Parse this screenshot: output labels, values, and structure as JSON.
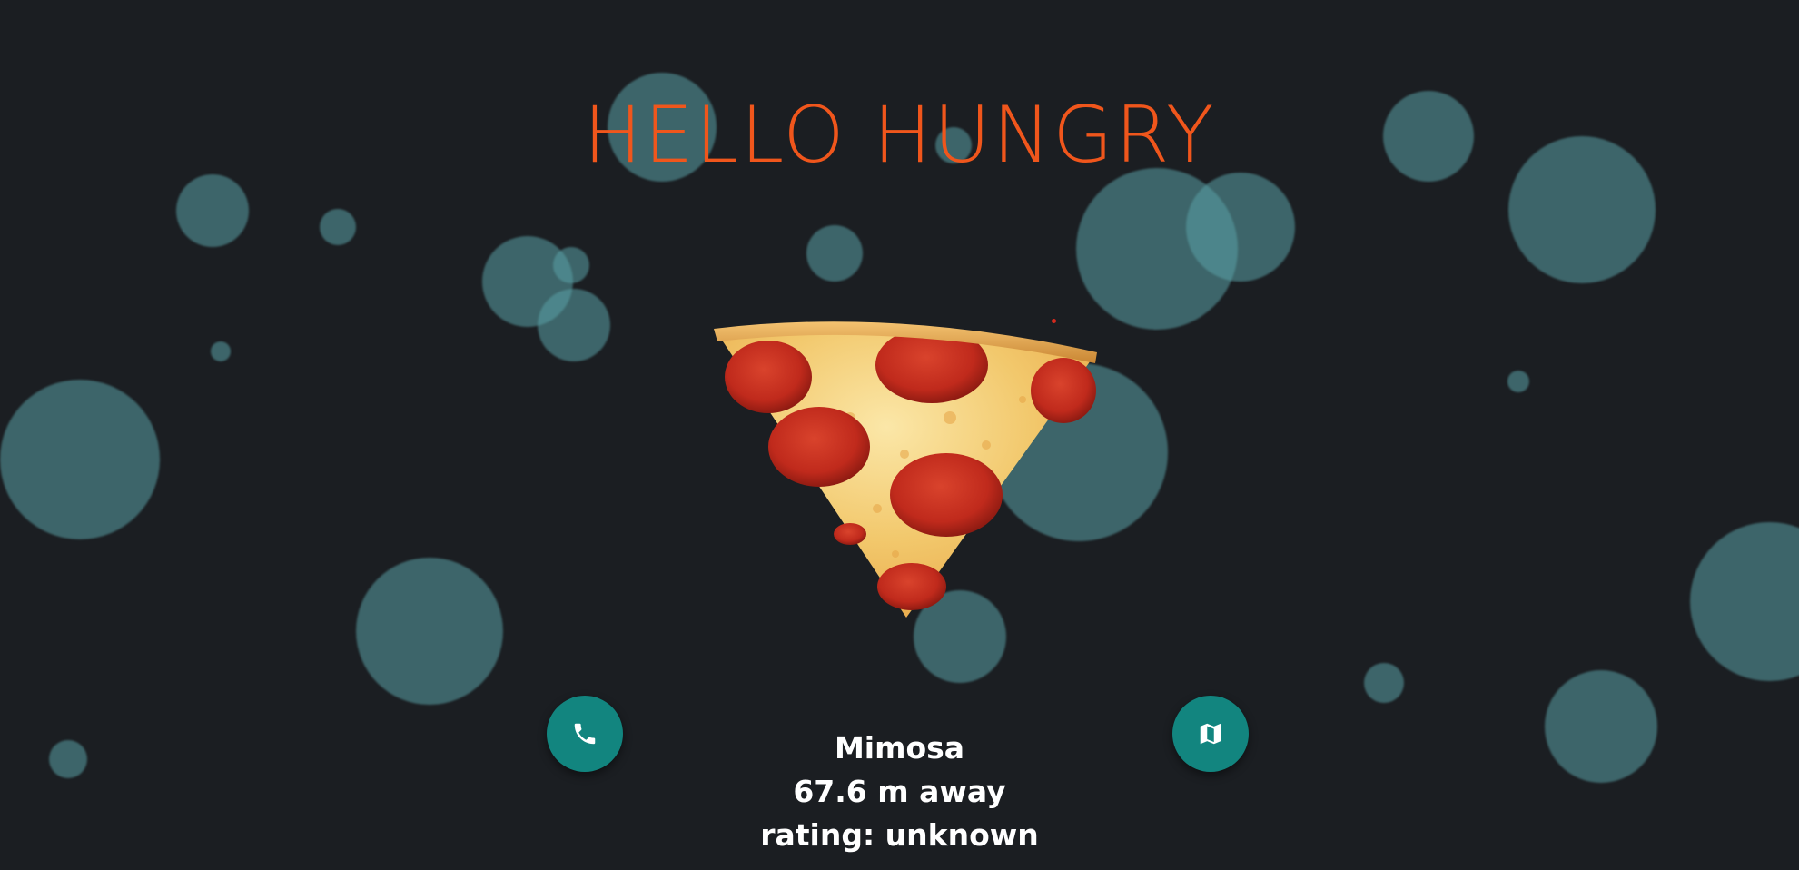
{
  "header": {
    "title": "HELLO HUNGRY"
  },
  "hero": {
    "image_icon": "pizza-slice-image"
  },
  "actions": {
    "call": {
      "icon": "phone-icon"
    },
    "map": {
      "icon": "map-icon"
    }
  },
  "place": {
    "name": "Mimosa",
    "distance": "67.6 m away",
    "rating": "rating: unknown"
  },
  "colors": {
    "background": "#1b1e22",
    "title": "#f0561c",
    "accent": "#12857f",
    "bubble": "#5aa0a5"
  }
}
